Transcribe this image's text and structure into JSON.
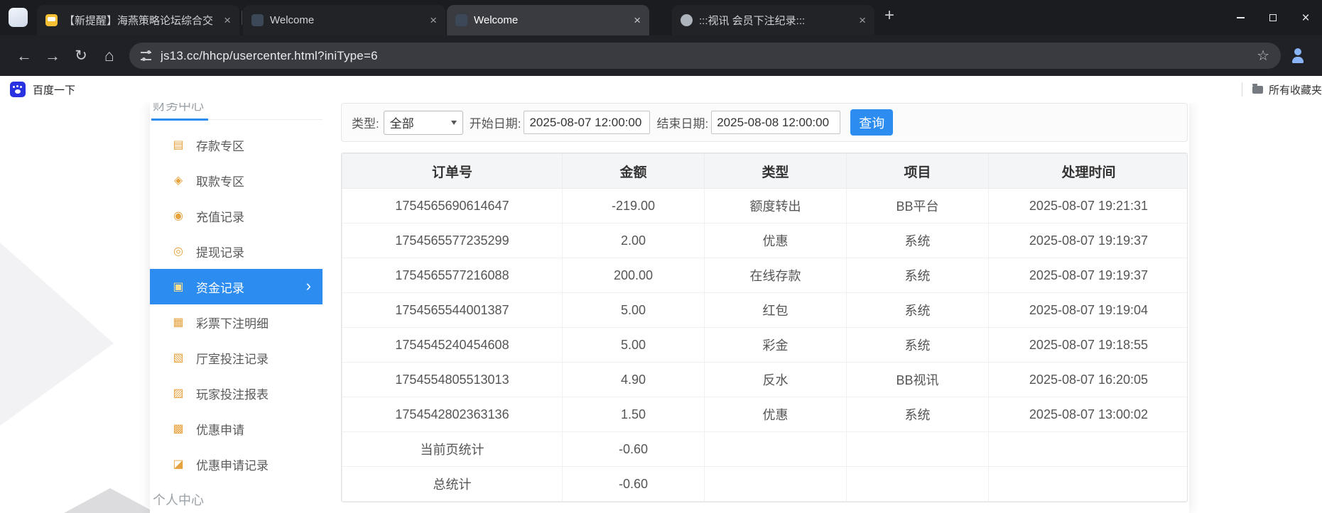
{
  "browser": {
    "tabs": [
      {
        "title": "【新提醒】海燕策略论坛综合交",
        "active": false
      },
      {
        "title": "Welcome",
        "active": false
      },
      {
        "title": "Welcome",
        "active": true
      },
      {
        "title": ":::视讯 会员下注纪录:::",
        "active": false
      }
    ],
    "url": "js13.cc/hhcp/usercenter.html?iniType=6",
    "bookmarks_bar": {
      "baidu_label": "百度一下",
      "all_bookmarks_label": "所有收藏夹"
    }
  },
  "icons": {
    "close": "×",
    "plus": "+",
    "back": "←",
    "forward": "→",
    "reload": "↻",
    "home": "⌂",
    "star": "☆",
    "chevron_right": "›"
  },
  "colors": {
    "accent_blue": "#2d8cf0",
    "sidebar_icon_orange": "#e6a23c",
    "query_button_blue": "#2d8cf0"
  },
  "sidebar": {
    "section_top": "财务中心",
    "section_bottom": "个人中心",
    "items": [
      {
        "label": "存款专区",
        "icon": "▤"
      },
      {
        "label": "取款专区",
        "icon": "◈"
      },
      {
        "label": "充值记录",
        "icon": "◉"
      },
      {
        "label": "提现记录",
        "icon": "◎"
      },
      {
        "label": "资金记录",
        "icon": "▣"
      },
      {
        "label": "彩票下注明细",
        "icon": "▦"
      },
      {
        "label": "厅室投注记录",
        "icon": "▧"
      },
      {
        "label": "玩家投注报表",
        "icon": "▨"
      },
      {
        "label": "优惠申请",
        "icon": "▩"
      },
      {
        "label": "优惠申请记录",
        "icon": "◪"
      }
    ]
  },
  "filters": {
    "type_label": "类型:",
    "type_value": "全部",
    "start_label": "开始日期:",
    "start_value": "2025-08-07 12:00:00",
    "end_label": "结束日期:",
    "end_value": "2025-08-08 12:00:00",
    "query_button": "查询"
  },
  "table": {
    "headers": [
      "订单号",
      "金额",
      "类型",
      "项目",
      "处理时间"
    ],
    "rows": [
      [
        "1754565690614647",
        "-219.00",
        "额度转出",
        "BB平台",
        "2025-08-07 19:21:31"
      ],
      [
        "1754565577235299",
        "2.00",
        "优惠",
        "系统",
        "2025-08-07 19:19:37"
      ],
      [
        "1754565577216088",
        "200.00",
        "在线存款",
        "系统",
        "2025-08-07 19:19:37"
      ],
      [
        "1754565544001387",
        "5.00",
        "红包",
        "系统",
        "2025-08-07 19:19:04"
      ],
      [
        "1754545240454608",
        "5.00",
        "彩金",
        "系统",
        "2025-08-07 19:18:55"
      ],
      [
        "1754554805513013",
        "4.90",
        "反水",
        "BB视讯",
        "2025-08-07 16:20:05"
      ],
      [
        "1754542802363136",
        "1.50",
        "优惠",
        "系统",
        "2025-08-07 13:00:02"
      ],
      [
        "当前页统计",
        "-0.60",
        "",
        "",
        ""
      ],
      [
        "总统计",
        "-0.60",
        "",
        "",
        ""
      ]
    ]
  }
}
